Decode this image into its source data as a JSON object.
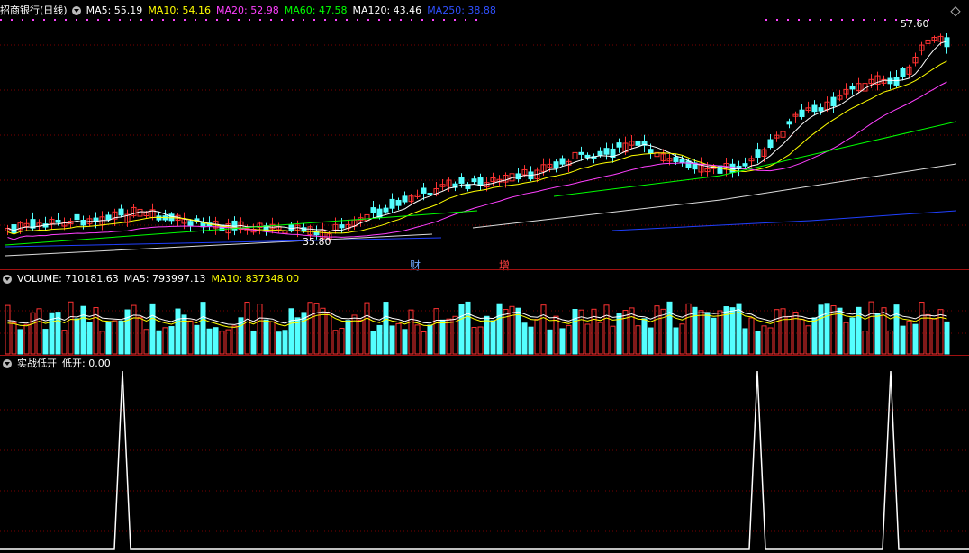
{
  "main": {
    "title": "招商银行(日线)",
    "ma": [
      {
        "label": "MA5: 55.19",
        "color": "#ffffff"
      },
      {
        "label": "MA10: 54.16",
        "color": "#ffff00"
      },
      {
        "label": "MA20: 52.98",
        "color": "#ff40ff"
      },
      {
        "label": "MA60: 47.58",
        "color": "#00ff00"
      },
      {
        "label": "MA120: 43.46",
        "color": "#ffffff"
      },
      {
        "label": "MA250: 38.88",
        "color": "#0000ff"
      }
    ],
    "high_label": "57.60",
    "low_label": "35.80",
    "markers": [
      {
        "text": "财",
        "color": "#6fa8ff"
      },
      {
        "text": "增",
        "color": "#ff4040"
      }
    ]
  },
  "volume": {
    "label": "VOLUME: 710181.63",
    "ma5": "MA5: 793997.13",
    "ma10": "MA10: 837348.00",
    "ma5_color": "#ffffff",
    "ma10_color": "#ffff00"
  },
  "indicator": {
    "label": "实战低开",
    "value": "低开: 0.00"
  },
  "colors": {
    "up": "#ff3232",
    "down": "#54ffff",
    "grid": "#7a0000",
    "border": "#a01010"
  }
}
